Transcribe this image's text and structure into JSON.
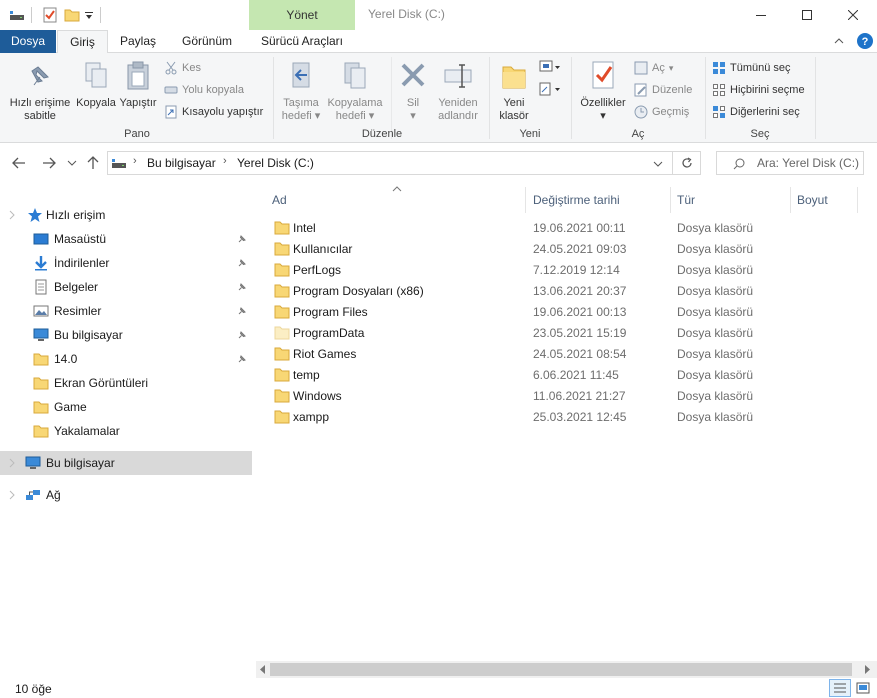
{
  "title_bar": {
    "context_tab": "Yönet",
    "window_title": "Yerel Disk (C:)"
  },
  "ribbon_tabs": {
    "file": "Dosya",
    "home": "Giriş",
    "share": "Paylaş",
    "view": "Görünüm",
    "drive_tools": "Sürücü Araçları"
  },
  "ribbon": {
    "pano": {
      "label": "Pano",
      "pin": [
        "Hızlı erişime",
        "sabitle"
      ],
      "copy": "Kopyala",
      "paste": "Yapıştır",
      "cut": "Kes",
      "copy_path": "Yolu kopyala",
      "paste_shortcut": "Kısayolu yapıştır"
    },
    "duzenle": {
      "label": "Düzenle",
      "move_to": [
        "Taşıma",
        "hedefi"
      ],
      "copy_to": [
        "Kopyalama",
        "hedefi"
      ],
      "delete": "Sil",
      "rename": [
        "Yeniden",
        "adlandır"
      ]
    },
    "yeni": {
      "label": "Yeni",
      "new_folder": [
        "Yeni",
        "klasör"
      ]
    },
    "ac": {
      "label": "Aç",
      "properties": "Özellikler",
      "open": "Aç",
      "edit": "Düzenle",
      "history": "Geçmiş"
    },
    "sec": {
      "label": "Seç",
      "select_all": "Tümünü seç",
      "select_none": "Hiçbirini seçme",
      "invert": "Diğerlerini seç"
    }
  },
  "address": {
    "crumb1": "Bu bilgisayar",
    "crumb2": "Yerel Disk (C:)",
    "search_placeholder": "Ara: Yerel Disk (C:)"
  },
  "navpane": {
    "quick_access": "Hızlı erişim",
    "items": [
      "Masaüstü",
      "İndirilenler",
      "Belgeler",
      "Resimler",
      "Bu bilgisayar",
      "14.0",
      "Ekran Görüntüleri",
      "Game",
      "Yakalamalar"
    ],
    "this_pc": "Bu bilgisayar",
    "network": "Ağ"
  },
  "columns": {
    "name": "Ad",
    "date": "Değiştirme tarihi",
    "type": "Tür",
    "size": "Boyut"
  },
  "files": [
    {
      "name": "Intel",
      "date": "19.06.2021 00:11",
      "type": "Dosya klasörü"
    },
    {
      "name": "Kullanıcılar",
      "date": "24.05.2021 09:03",
      "type": "Dosya klasörü"
    },
    {
      "name": "PerfLogs",
      "date": "7.12.2019 12:14",
      "type": "Dosya klasörü"
    },
    {
      "name": "Program Dosyaları (x86)",
      "date": "13.06.2021 20:37",
      "type": "Dosya klasörü"
    },
    {
      "name": "Program Files",
      "date": "19.06.2021 00:13",
      "type": "Dosya klasörü"
    },
    {
      "name": "ProgramData",
      "date": "23.05.2021 15:19",
      "type": "Dosya klasörü"
    },
    {
      "name": "Riot Games",
      "date": "24.05.2021 08:54",
      "type": "Dosya klasörü"
    },
    {
      "name": "temp",
      "date": "6.06.2021 11:45",
      "type": "Dosya klasörü"
    },
    {
      "name": "Windows",
      "date": "11.06.2021 21:27",
      "type": "Dosya klasörü"
    },
    {
      "name": "xampp",
      "date": "25.03.2021 12:45",
      "type": "Dosya klasörü"
    }
  ],
  "status": {
    "count": "10 öğe"
  },
  "colors": {
    "file_tab": "#1e5c99",
    "context_tab": "#c5e7b1",
    "folder": "#f8d775",
    "selection": "#d9d9d9"
  }
}
